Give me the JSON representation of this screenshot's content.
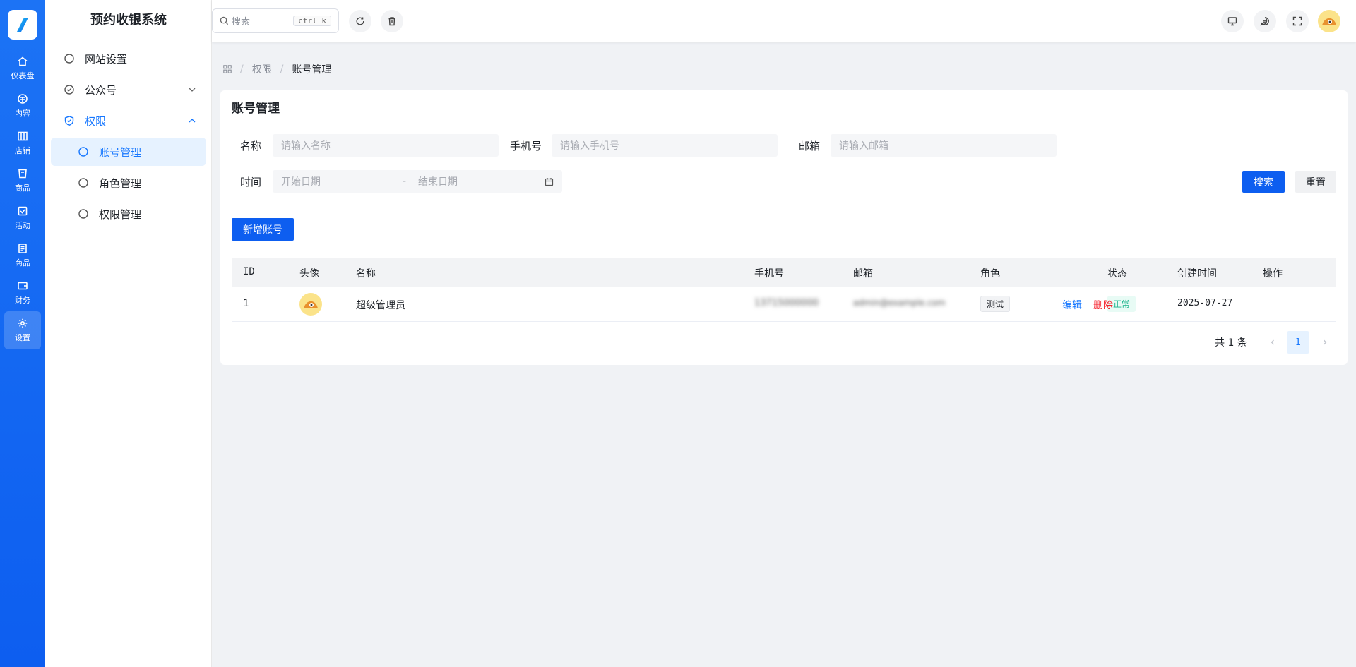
{
  "rail": {
    "items": [
      {
        "label": "仪表盘",
        "icon": "home-icon"
      },
      {
        "label": "内容",
        "icon": "content-icon"
      },
      {
        "label": "店铺",
        "icon": "store-icon"
      },
      {
        "label": "商品",
        "icon": "goods-icon"
      },
      {
        "label": "活动",
        "icon": "activity-icon"
      },
      {
        "label": "商品",
        "icon": "goods-list-icon"
      },
      {
        "label": "财务",
        "icon": "wallet-icon"
      },
      {
        "label": "设置",
        "icon": "gear-icon"
      }
    ],
    "active_index": 7
  },
  "sidebar": {
    "title": "预约收银系统",
    "items": [
      {
        "label": "网站设置"
      },
      {
        "label": "公众号"
      },
      {
        "label": "权限"
      },
      {
        "label": "账号管理"
      },
      {
        "label": "角色管理"
      },
      {
        "label": "权限管理"
      }
    ]
  },
  "header": {
    "search": {
      "placeholder": "搜索",
      "shortcut": "ctrl k"
    }
  },
  "breadcrumb": {
    "items": [
      "权限",
      "账号管理"
    ],
    "separator": "/"
  },
  "page": {
    "title": "账号管理",
    "filters": {
      "name_label": "名称",
      "name_placeholder": "请输入名称",
      "phone_label": "手机号",
      "phone_placeholder": "请输入手机号",
      "email_label": "邮箱",
      "email_placeholder": "请输入邮箱",
      "time_label": "时间",
      "start_placeholder": "开始日期",
      "range_sep": "-",
      "end_placeholder": "结束日期"
    },
    "search_button": "搜索",
    "reset_button": "重置",
    "add_button": "新增账号"
  },
  "table": {
    "columns": [
      "ID",
      "头像",
      "名称",
      "手机号",
      "邮箱",
      "角色",
      "状态",
      "创建时间",
      "操作"
    ],
    "rows": [
      {
        "id": "1",
        "name": "超级管理员",
        "phone": "13715000000",
        "email": "admin@example.com",
        "role": "测试",
        "status": "正常",
        "created": "2025-07-27",
        "edit": "编辑",
        "delete": "删除"
      }
    ]
  },
  "pagination": {
    "total_text": "共 1 条",
    "current_page": "1"
  },
  "colors": {
    "primary": "#0d5ef0",
    "link": "#1677ff",
    "danger": "#f5222d",
    "success": "#18b38a"
  }
}
